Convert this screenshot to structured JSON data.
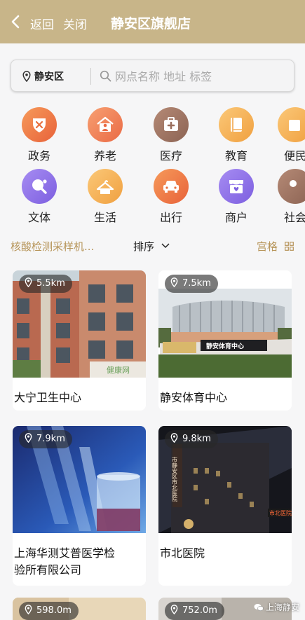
{
  "header": {
    "back_label": "返回",
    "close_label": "关闭",
    "title": "静安区旗舰店",
    "bg_color": "#c8b589"
  },
  "search": {
    "district": "静安区",
    "placeholder": "网点名称 地址 标签"
  },
  "categories_row1": [
    "政务",
    "养老",
    "医疗",
    "教育",
    "便民"
  ],
  "categories_row2": [
    "文体",
    "生活",
    "出行",
    "商户",
    "社会"
  ],
  "filter": {
    "left": "核酸检测采样机...",
    "sort": "排序",
    "view": "宫格"
  },
  "cards": [
    {
      "distance": "5.5km",
      "name": "大宁卫生中心",
      "photo_watermark": "健康网"
    },
    {
      "distance": "7.5km",
      "name": "静安体育中心",
      "sign_text": "静安体育中心"
    },
    {
      "distance": "7.9km",
      "name_line1": "上海华测艾普医学检",
      "name_line2": "验所有限公司"
    },
    {
      "distance": "9.8km",
      "name": "市北医院",
      "building_text": "市静安区市北医院",
      "building_sign": "市北医院"
    },
    {
      "distance": "598.0m"
    },
    {
      "distance": "752.0m"
    }
  ],
  "watermark": "上海静安",
  "colors": {
    "accent": "#b7955a",
    "header": "#c8b589"
  }
}
